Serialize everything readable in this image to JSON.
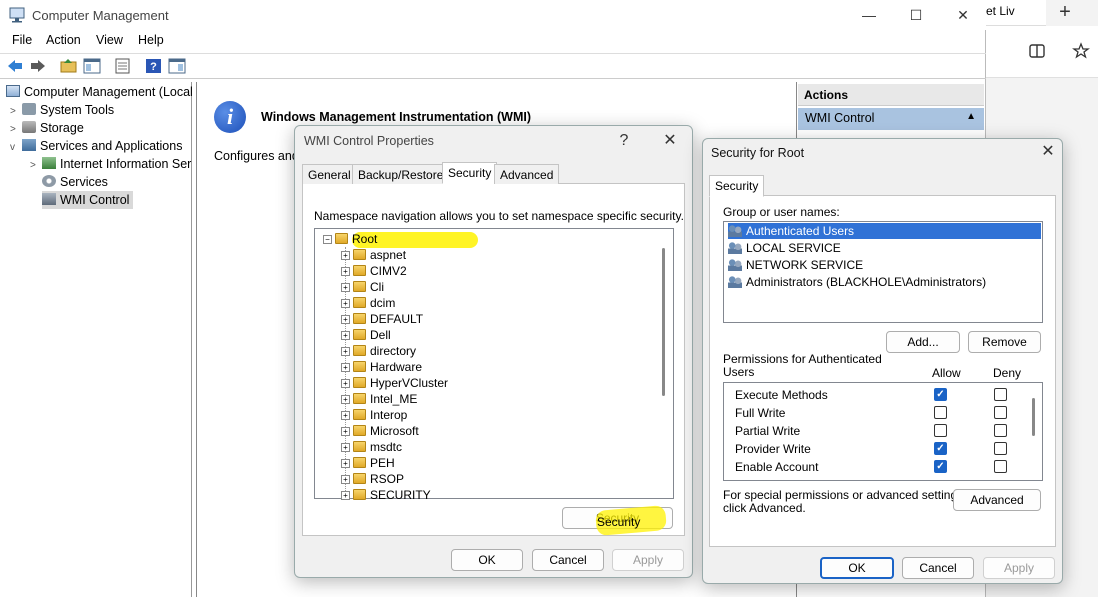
{
  "browser": {
    "tab_fragment": "et Liv",
    "new_tab": "+"
  },
  "mmc": {
    "title": "Computer Management",
    "menu": [
      "File",
      "Action",
      "View",
      "Help"
    ],
    "tree": [
      {
        "label": "Computer Management (Local",
        "twisty": ""
      },
      {
        "label": "System Tools",
        "twisty": ">"
      },
      {
        "label": "Storage",
        "twisty": ">"
      },
      {
        "label": "Services and Applications",
        "twisty": "v"
      },
      {
        "label": "Internet Information Ser",
        "twisty": ">"
      },
      {
        "label": "Services",
        "twisty": ""
      },
      {
        "label": "WMI Control",
        "twisty": ""
      }
    ],
    "center": {
      "heading": "Windows Management Instrumentation (WMI)",
      "description": "Configures and"
    },
    "actions": {
      "header": "Actions",
      "item": "WMI Control"
    }
  },
  "wmi_props": {
    "title": "WMI Control Properties",
    "help": "?",
    "tabs": [
      "General",
      "Backup/Restore",
      "Security",
      "Advanced"
    ],
    "active_tab": "Security",
    "intro": "Namespace navigation allows you to set namespace specific security.",
    "root": "Root",
    "namespaces": [
      "aspnet",
      "CIMV2",
      "Cli",
      "dcim",
      "DEFAULT",
      "Dell",
      "directory",
      "Hardware",
      "HyperVCluster",
      "Intel_ME",
      "Interop",
      "Microsoft",
      "msdtc",
      "PEH",
      "RSOP",
      "SECURITY"
    ],
    "security_button": "Security",
    "ok": "OK",
    "cancel": "Cancel",
    "apply": "Apply"
  },
  "security_root": {
    "title": "Security for Root",
    "tab": "Security",
    "group_label": "Group or user names:",
    "users": [
      "Authenticated Users",
      "LOCAL SERVICE",
      "NETWORK SERVICE",
      "Administrators (BLACKHOLE\\Administrators)"
    ],
    "selected_user": "Authenticated Users",
    "add": "Add...",
    "remove": "Remove",
    "perm_label_line1": "Permissions for Authenticated",
    "perm_label_line2": "Users",
    "allow": "Allow",
    "deny": "Deny",
    "permissions": [
      {
        "name": "Execute Methods",
        "allow": true,
        "deny": false
      },
      {
        "name": "Full Write",
        "allow": false,
        "deny": false
      },
      {
        "name": "Partial Write",
        "allow": false,
        "deny": false
      },
      {
        "name": "Provider Write",
        "allow": true,
        "deny": false
      },
      {
        "name": "Enable Account",
        "allow": true,
        "deny": false
      }
    ],
    "special_line1": "For special permissions or advanced settings,",
    "special_line2": "click Advanced.",
    "advanced": "Advanced",
    "ok": "OK",
    "cancel": "Cancel",
    "apply": "Apply"
  },
  "colors": {
    "accent": "#1a63c6",
    "highlight": "#fff200",
    "selection": "#3072d6"
  }
}
